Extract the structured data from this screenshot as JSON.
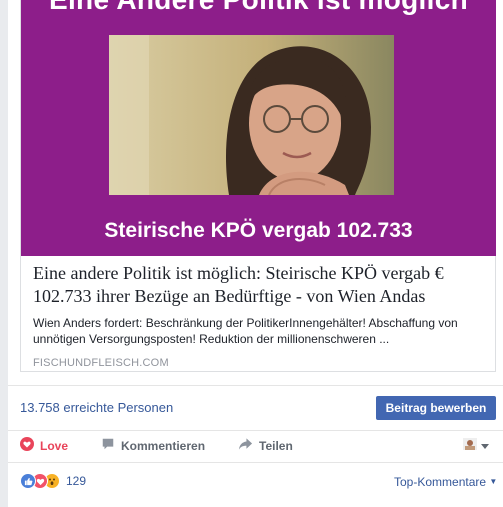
{
  "link_preview": {
    "image_headline": "Eine Andere Politik ist möglich",
    "image_caption": "Steirische KPÖ vergab 102.733",
    "title": "Eine andere Politik ist möglich: Steirische KPÖ vergab € 102.733 ihrer Bezüge an Bedürftige - von Wien Andas",
    "description": "Wien Anders fordert: Beschränkung der PolitikerInnengehälter! Abschaffung von unnötigen Versorgungsposten! Reduktion der millionenschweren ...",
    "domain": "FISCHUNDFLEISCH.COM",
    "background_color": "#8d1e8a"
  },
  "insights": {
    "reach_text": "13.758 erreichte Personen",
    "promote_label": "Beitrag bewerben"
  },
  "actions": {
    "love_label": "Love",
    "comment_label": "Kommentieren",
    "share_label": "Teilen"
  },
  "reactions": {
    "count": "129",
    "sort_label": "Top-Kommentare"
  },
  "colors": {
    "accent": "#4267b2",
    "love": "#e9445a",
    "link": "#365899"
  }
}
